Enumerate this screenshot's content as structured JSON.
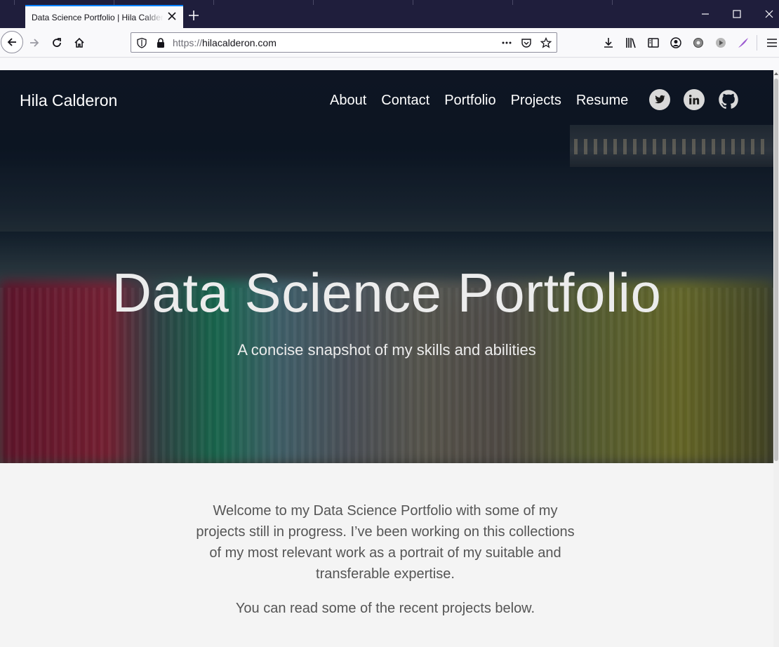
{
  "browser": {
    "tab_title": "Data Science Portfolio | Hila Calderon",
    "url_scheme": "https://",
    "url_host": "hilacalderon.com",
    "active_tab_accent": "#0a84ff",
    "tabstrip_color": "#1f1e3c"
  },
  "site": {
    "brand": "Hila Calderon",
    "nav": [
      "About",
      "Contact",
      "Portfolio",
      "Projects",
      "Resume"
    ],
    "social_icons": [
      "twitter-icon",
      "linkedin-icon",
      "github-icon"
    ]
  },
  "hero": {
    "title": "Data Science Portfolio",
    "subtitle": "A concise snapshot of my skills and abilities"
  },
  "content": {
    "intro": "Welcome to my Data Science Portfolio with some of my projects still in progress. I’ve been working on this collections of my most relevant work as a portrait of my suitable and transferable expertise.",
    "recent": "You can read some of the recent projects below."
  }
}
